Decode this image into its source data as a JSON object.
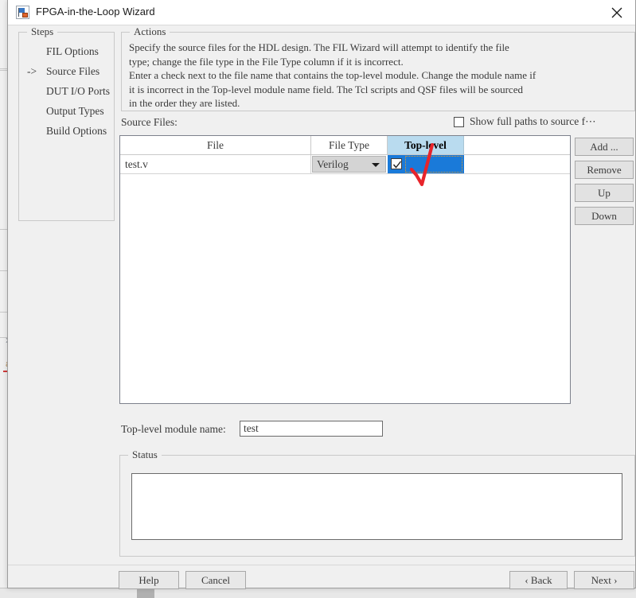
{
  "window": {
    "title": "FPGA-in-the-Loop Wizard",
    "app_icon": "fpga-wizard-icon",
    "close_icon": "close-icon"
  },
  "steps": {
    "legend": "Steps",
    "items": [
      {
        "arrow": "",
        "label": "FIL Options",
        "current": false
      },
      {
        "arrow": "->",
        "label": "Source Files",
        "current": true
      },
      {
        "arrow": "",
        "label": "DUT I/O Ports",
        "current": false
      },
      {
        "arrow": "",
        "label": "Output Types",
        "current": false
      },
      {
        "arrow": "",
        "label": "Build Options",
        "current": false
      }
    ]
  },
  "actions": {
    "legend": "Actions",
    "text": "Specify the source files for the HDL design. The FIL Wizard will attempt to identify the file\ntype; change the file type in the File Type column if it is incorrect.\nEnter a check next to the file name that contains the top-level module. Change the module name if\nit is incorrect in the Top-level module name field. The Tcl scripts and QSF files will be sourced\nin the order they are listed."
  },
  "source_files": {
    "label": "Source Files:",
    "show_full_paths": {
      "label": "Show full paths to source f⋯",
      "checked": false
    },
    "table": {
      "columns": [
        "File",
        "File Type",
        "Top-level",
        ""
      ],
      "selected_column": "Top-level",
      "rows": [
        {
          "file": "test.v",
          "file_type": "Verilog",
          "file_type_options": [
            "Verilog"
          ],
          "top_level": true
        }
      ]
    },
    "buttons": [
      {
        "label": "Add ...",
        "name": "add-button"
      },
      {
        "label": "Remove",
        "name": "remove-button"
      },
      {
        "label": "Up",
        "name": "up-button"
      },
      {
        "label": "Down",
        "name": "down-button"
      }
    ]
  },
  "module_name": {
    "label": "Top-level module name:",
    "value": "test",
    "placeholder": ""
  },
  "status": {
    "legend": "Status",
    "text": ""
  },
  "footer": {
    "help": "Help",
    "cancel": "Cancel",
    "back": "‹ Back",
    "next": "Next ›"
  },
  "annotation": {
    "type": "hand-drawn-check-mark",
    "color": "#e8242b"
  },
  "colors": {
    "selection_blue": "#1a7ad9",
    "header_selected_blue": "#b9dbef",
    "focus_outline": "#e39a2a",
    "dialog_bg": "#f0f0f0",
    "annotation_red": "#e8242b"
  }
}
